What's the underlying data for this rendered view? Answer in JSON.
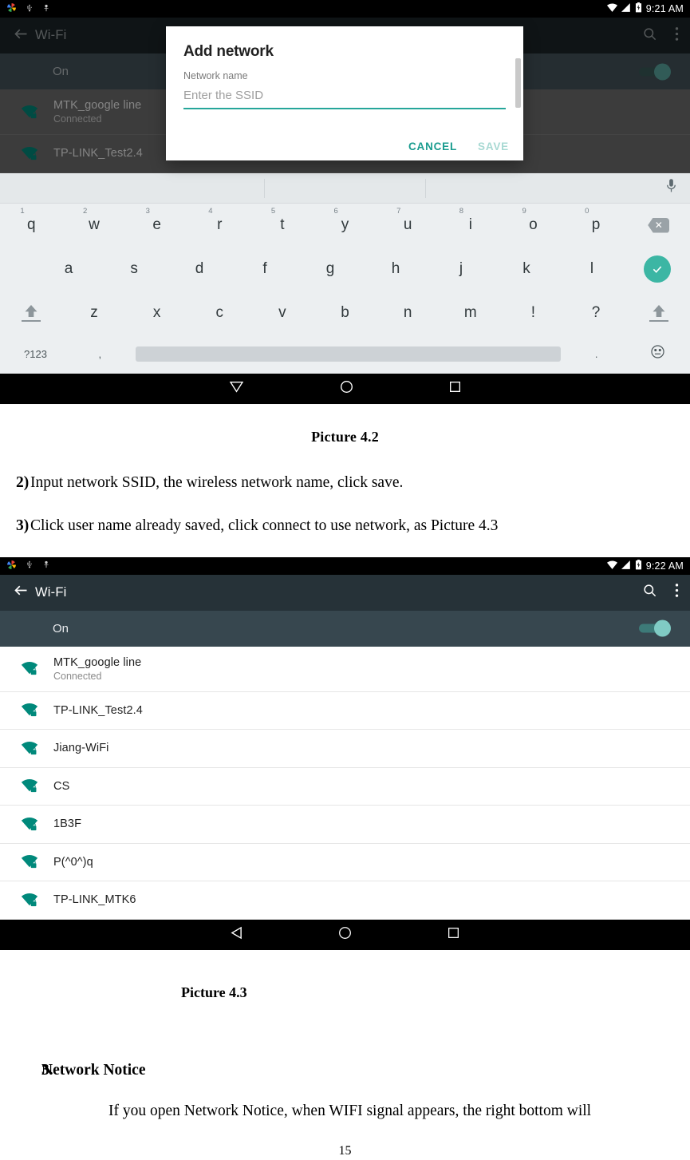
{
  "shot1": {
    "statusbar": {
      "icons": [
        "google-photos-icon",
        "usb-icon",
        "debug-icon"
      ],
      "right_icons": [
        "wifi-icon",
        "signal-icon",
        "battery-charging-icon"
      ],
      "clock": "9:21 AM"
    },
    "appbar": {
      "title": "Wi-Fi",
      "back": "back-arrow-icon",
      "search": "search-icon",
      "overflow": "overflow-menu-icon"
    },
    "toggle_row": {
      "label": "On",
      "state": "on"
    },
    "networks": [
      {
        "ssid": "MTK_google line",
        "status": "Connected",
        "secured": true
      },
      {
        "ssid": "TP-LINK_Test2.4",
        "status": "",
        "secured": true
      }
    ],
    "dialog": {
      "title": "Add network",
      "field_label": "Network name",
      "placeholder": "Enter the SSID",
      "value": "",
      "cancel_label": "CANCEL",
      "save_label": "SAVE"
    },
    "keyboard": {
      "row1": [
        {
          "key": "q",
          "hint": "1"
        },
        {
          "key": "w",
          "hint": "2"
        },
        {
          "key": "e",
          "hint": "3"
        },
        {
          "key": "r",
          "hint": "4"
        },
        {
          "key": "t",
          "hint": "5"
        },
        {
          "key": "y",
          "hint": "6"
        },
        {
          "key": "u",
          "hint": "7"
        },
        {
          "key": "i",
          "hint": "8"
        },
        {
          "key": "o",
          "hint": "9"
        },
        {
          "key": "p",
          "hint": "0"
        }
      ],
      "row2": [
        "a",
        "s",
        "d",
        "f",
        "g",
        "h",
        "j",
        "k",
        "l"
      ],
      "row3": [
        "z",
        "x",
        "c",
        "v",
        "b",
        "n",
        "m",
        "!",
        "?"
      ],
      "symbols_key": "?123",
      "comma_key": ",",
      "period_key": ".",
      "backspace": "backspace-icon",
      "enter": "enter-check-icon",
      "emoji": "emoji-icon",
      "mic": "microphone-icon",
      "shift": "shift-icon"
    },
    "navbar": [
      "back-triangle-icon",
      "home-circle-icon",
      "recents-square-icon"
    ]
  },
  "doc": {
    "caption_42": "Picture 4.2",
    "caption_43": "Picture 4.3",
    "item2_num": "2)",
    "item2_text": "Input network SSID, the wireless network name, click save.",
    "item3_num": "3)",
    "item3_text": "Click user name already saved, click connect to use network, as Picture 4.3",
    "section3_num": "3.",
    "section3_title": "Network Notice",
    "section3_body": "If you open Network Notice, when WIFI signal appears, the right bottom will",
    "page_number": "15"
  },
  "shot2": {
    "statusbar": {
      "icons": [
        "google-photos-icon",
        "usb-icon",
        "debug-icon"
      ],
      "right_icons": [
        "wifi-icon",
        "signal-icon",
        "battery-charging-icon"
      ],
      "clock": "9:22 AM"
    },
    "appbar": {
      "title": "Wi-Fi",
      "back": "back-arrow-icon",
      "search": "search-icon",
      "overflow": "overflow-menu-icon"
    },
    "toggle_row": {
      "label": "On",
      "state": "on"
    },
    "networks": [
      {
        "ssid": "MTK_google line",
        "status": "Connected",
        "secured": true
      },
      {
        "ssid": "TP-LINK_Test2.4",
        "status": "",
        "secured": true
      },
      {
        "ssid": "Jiang-WiFi",
        "status": "",
        "secured": true
      },
      {
        "ssid": "CS",
        "status": "",
        "secured": true
      },
      {
        "ssid": "1B3F",
        "status": "",
        "secured": true
      },
      {
        "ssid": "P(^0^)q",
        "status": "",
        "secured": true
      },
      {
        "ssid": "TP-LINK_MTK6",
        "status": "",
        "secured": true
      }
    ],
    "navbar": [
      "back-triangle-icon",
      "home-circle-icon",
      "recents-square-icon"
    ]
  },
  "colors": {
    "appbar": "#263238",
    "toggle_row": "#37474F",
    "accent_teal": "#26a69a",
    "wifi_icon": "#00897B",
    "statusbar": "#000000"
  }
}
